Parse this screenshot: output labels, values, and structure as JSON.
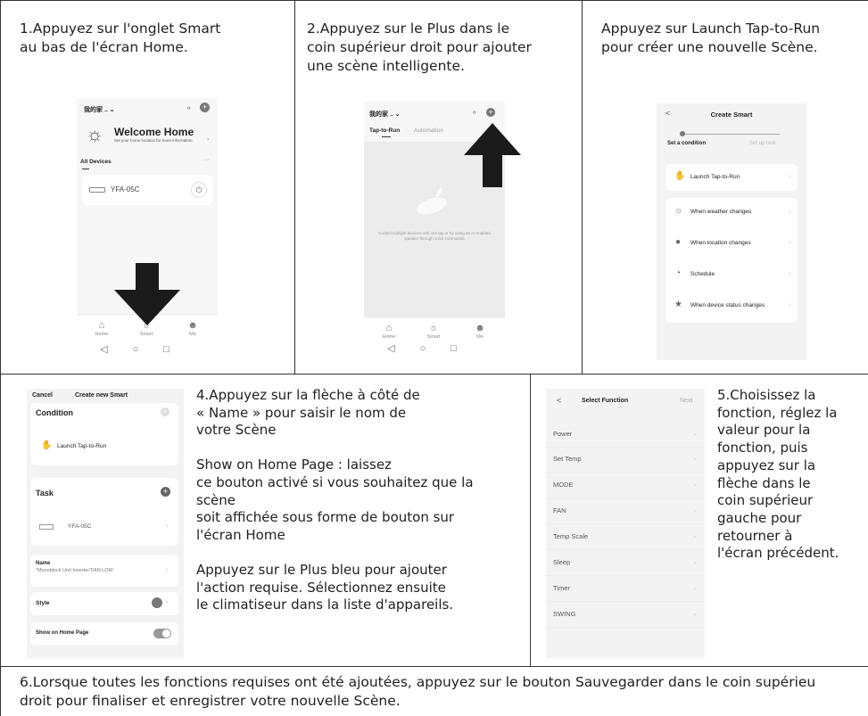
{
  "steps": {
    "s1": {
      "text": "1.Appuyez sur l'onglet Smart\nau bas de l'écran Home."
    },
    "s2": {
      "text": "2.Appuyez sur le Plus dans le\ncoin supérieur droit pour ajouter\nune scène intelligente."
    },
    "s3": {
      "text": "Appuyez sur Launch Tap-to-Run\npour créer une nouvelle Scène."
    },
    "s4": {
      "text": "4.Appuyez sur la flèche à côté de\n« Name » pour saisir le nom de\nvotre Scène\n\nShow on Home Page : laissez\nce bouton activé si vous souhaitez que la\nscène\nsoit affichée sous forme de bouton sur\nl'écran Home\n\nAppuyez sur le Plus bleu pour ajouter\nl'action requise. Sélectionnez ensuite\nle climatiseur dans la liste d'appareils."
    },
    "s5": {
      "text": "5.Choisissez la\nfonction, réglez la\nvaleur pour la\nfonction, puis\nappuyez sur la\nflèche dans le\ncoin supérieur\ngauche pour\nretourner à\nl'écran précédent."
    },
    "s6": {
      "text": "6.Lorsque toutes les fonctions requises ont été ajoutées, appuyez sur le bouton Sauvegarder dans le coin supérieu\ndroit pour finaliser et enregistrer votre nouvelle Scène."
    }
  },
  "screen1": {
    "home_name": "我的家 .. ⌄",
    "welcome_title": "Welcome Home",
    "welcome_sub": "Set your home location for more information",
    "all_devices": "All Devices",
    "more": "···",
    "device_name": "YFA-05C",
    "nav": [
      "Home",
      "Smart",
      "Me"
    ]
  },
  "screen2": {
    "home_name": "我的家 .. ⌄",
    "tab_active": "Tap-to-Run",
    "tab_other": "Automation",
    "empty_text": "Control multiple devices with one tap or by using an AI-enabled speaker through voice commands",
    "nav": [
      "Home",
      "Smart",
      "Me"
    ]
  },
  "screen3": {
    "back": "<",
    "title": "Create Smart",
    "step1": "Set a condition",
    "step2": "Set up task",
    "options": [
      "Launch Tap-to-Run",
      "When weather changes",
      "When location changes",
      "Schedule",
      "When device status changes"
    ]
  },
  "screen4": {
    "cancel": "Cancel",
    "title": "Create new Smart",
    "condition": "Condition",
    "condition_item": "Launch Tap-to-Run",
    "task": "Task",
    "task_item": "YFA-05C",
    "name_label": "Name",
    "name_value": "\"Monoblock Unit Inverter\"FAN:LOW",
    "style": "Style",
    "show_home": "Show on Home Page"
  },
  "screen5": {
    "back": "<",
    "title": "Select Function",
    "next": "Next",
    "functions": [
      "Power",
      "Set Temp",
      "MODE",
      "FAN",
      "Temp Scale",
      "Sleep",
      "Timer",
      "SWING"
    ]
  }
}
